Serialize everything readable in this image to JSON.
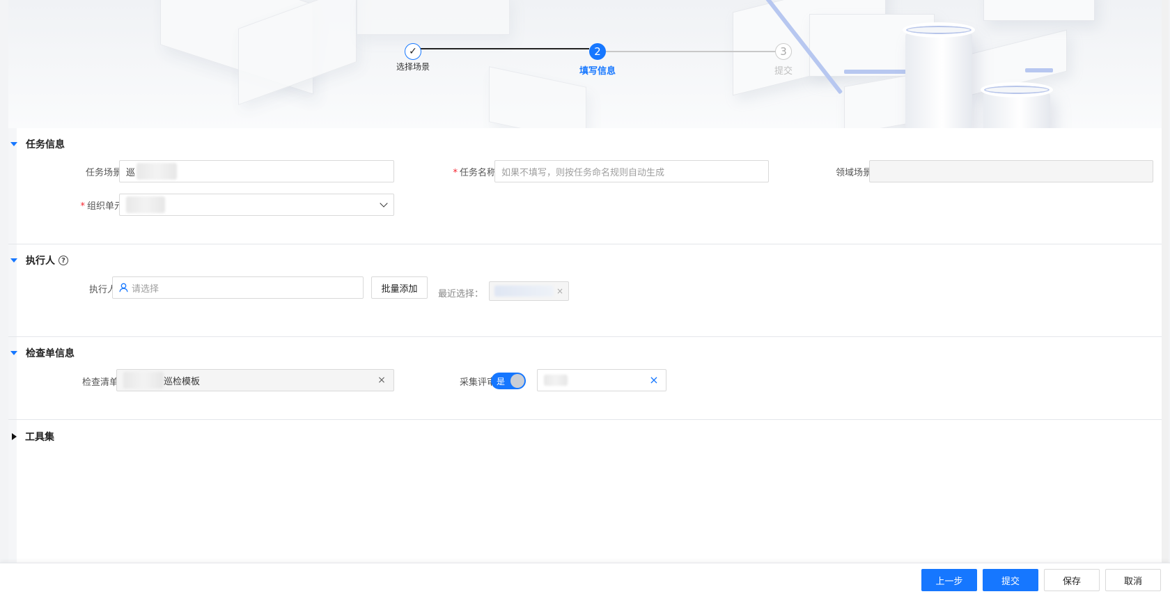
{
  "steps": [
    {
      "number": "✓",
      "label": "选择场景",
      "status": "done"
    },
    {
      "number": "2",
      "label": "填写信息",
      "status": "active"
    },
    {
      "number": "3",
      "label": "提交",
      "status": "pending"
    }
  ],
  "sections": {
    "task_info": {
      "title": "任务信息",
      "task_scene_label": "任务场景",
      "task_scene_value": "巡",
      "task_name_label": "任务名称",
      "task_name_placeholder": "如果不填写，则按任务命名规则自动生成",
      "domain_scene_label": "领域场景",
      "domain_scene_value": "",
      "org_unit_label": "组织单元",
      "org_unit_value": ""
    },
    "executor": {
      "title": "执行人",
      "help_icon": "?",
      "executor_label": "执行人",
      "executor_placeholder": "请选择",
      "batch_add_label": "批量添加",
      "recent_label": "最近选择："
    },
    "checklist": {
      "title": "检查单信息",
      "checklist_label": "检查清单",
      "checklist_value": "巡检模板",
      "collect_review_label": "采集评审",
      "toggle_text": "是",
      "reviewer_value": ""
    },
    "toolset": {
      "title": "工具集"
    }
  },
  "footer": {
    "prev_label": "上一步",
    "submit_label": "提交",
    "save_label": "保存",
    "cancel_label": "取消"
  },
  "colors": {
    "primary": "#1677ff",
    "required": "#f5222d",
    "done_line": "#222222",
    "pending": "#c8c8c8"
  }
}
